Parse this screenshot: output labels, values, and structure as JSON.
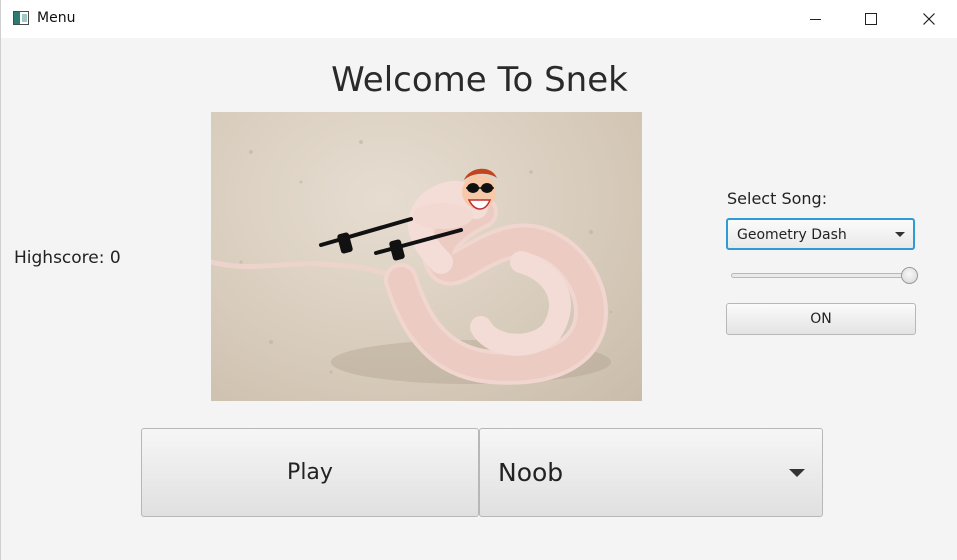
{
  "window": {
    "title": "Menu",
    "icon": "java-app-icon",
    "controls": [
      "minimize-icon",
      "maximize-icon",
      "close-icon"
    ]
  },
  "main": {
    "heading": "Welcome To Snek",
    "highscore": "Highscore: 0",
    "image": {
      "subject": "snake-with-sunglasses"
    },
    "music": {
      "label": "Select Song:",
      "selected_song": "Geometry Dash",
      "volume_level": 1.0,
      "toggle_label": "ON"
    },
    "play_label": "Play",
    "difficulty": "Noob"
  },
  "colors": {
    "focus_ring": "#2f9bd6",
    "background": "#f4f4f4"
  }
}
